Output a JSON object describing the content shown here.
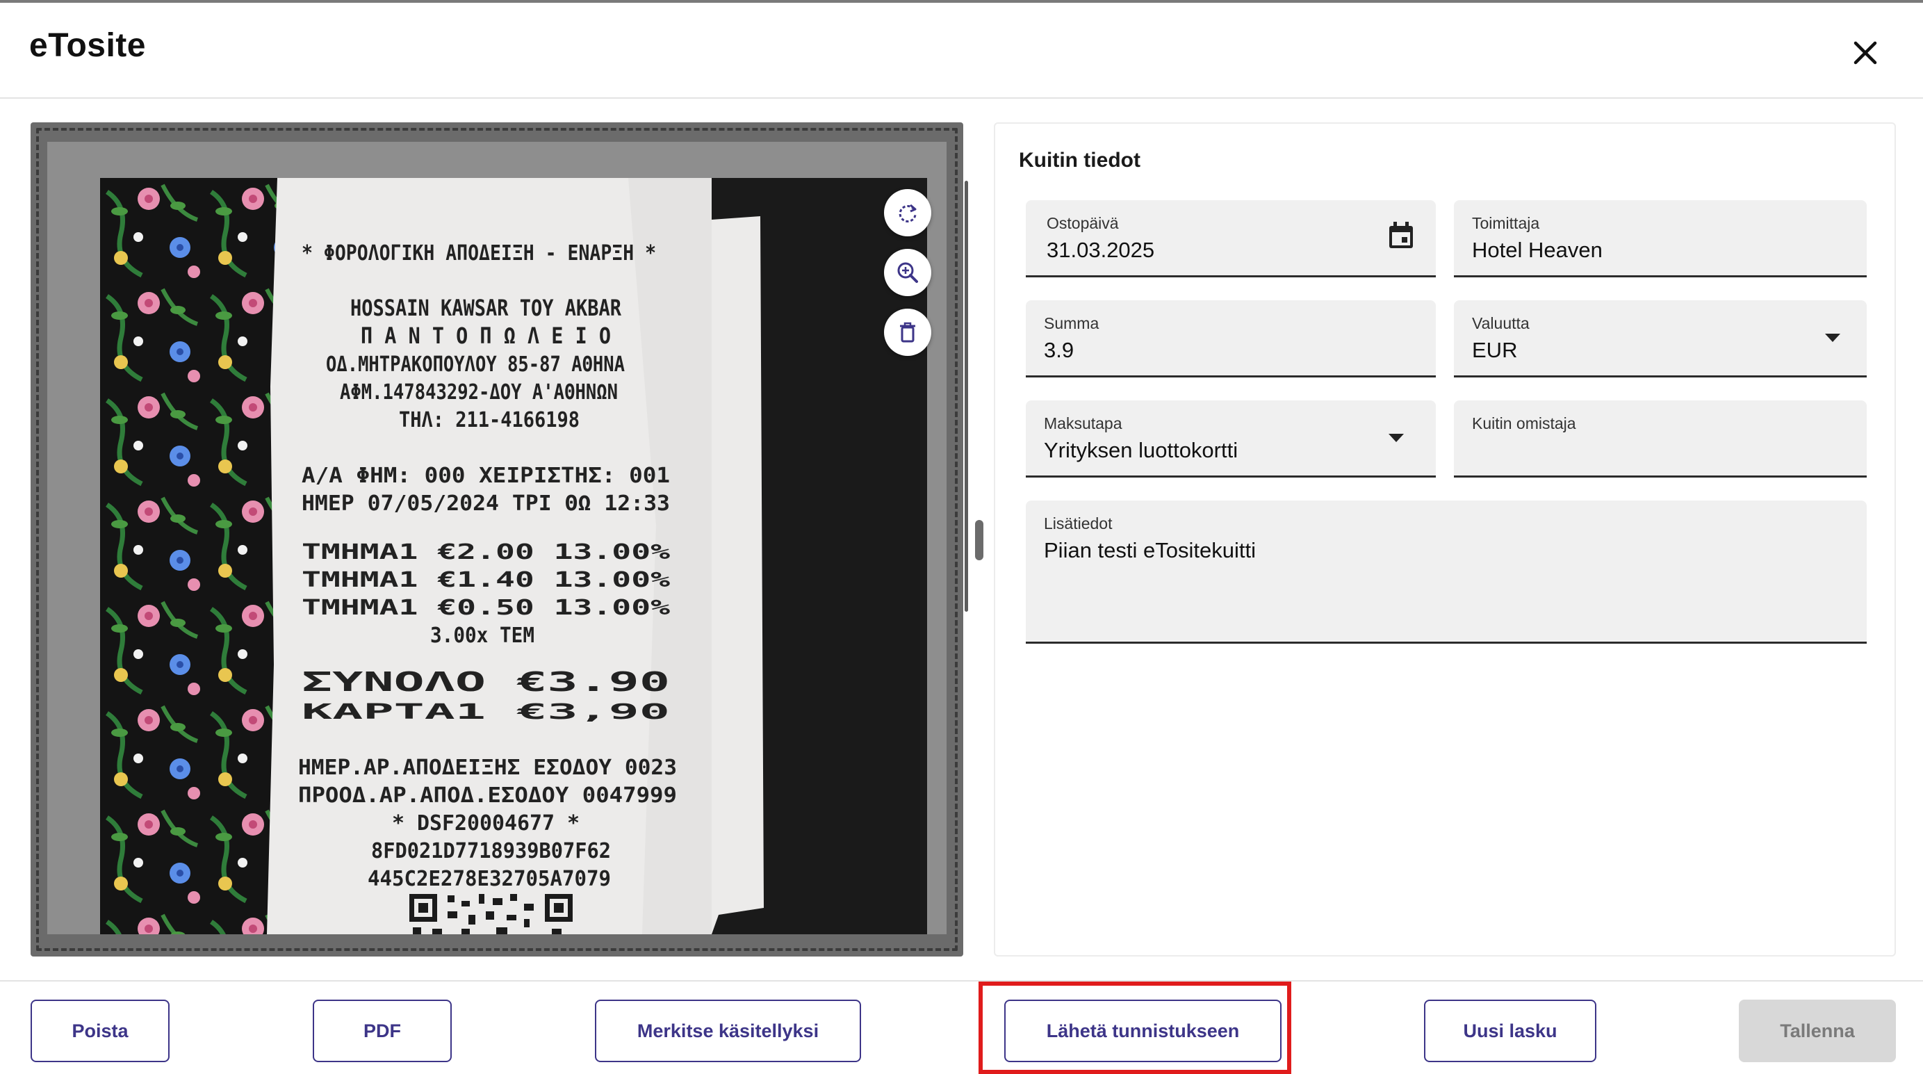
{
  "app": {
    "title": "eTosite",
    "close_icon": "close-icon"
  },
  "preview": {
    "actions": [
      {
        "name": "rotate-icon"
      },
      {
        "name": "zoom-in-icon"
      },
      {
        "name": "delete-icon"
      }
    ],
    "receipt_lines": [
      "* ΦΟΡΟΛΟΓΙΚΗ ΑΠΟΔΕΙΞΗ - ΕΝΑΡΞΗ *",
      "HOSSAIN KAWSAR TOY AKBAR",
      "Π Α Ν Τ Ο Π Ω Λ Ε Ι Ο",
      "ΟΔ.ΜΗΤΡΑΚΟΠΟΥΛΟΥ 85-87 ΑΘΗΝΑ",
      "ΑΦΜ.147843292-ΔΟΥ Α'ΑΘΗΝΩΝ",
      "ΤΗΛ: 211-4166198",
      "Α/Α ΦΗΜ: 000      ΧΕΙΡΙΣΤΗΣ: 001",
      "ΗΜΕΡ 07/05/2024 ΤΡΙ  ΘΩ    12:33",
      "ΤΜΗΜΑ1              €2.00 13.00%",
      "ΤΜΗΜΑ1              €1.40 13.00%",
      "ΤΜΗΜΑ1              €0.50 13.00%",
      "3.00x ΤΕΜ",
      "ΣΥΝΟΛΟ             €3.90",
      "ΚΑΡΤΑ1             €3,90",
      "ΗΜΕΡ.ΑΡ.ΑΠΟΔΕΙΞΗΣ ΕΣΟΔΟΥ    0023",
      "ΠΡΟΟΔ.ΑΡ.ΑΠΟΔ.ΕΣΟΔΟΥ     0047999",
      "* DSF20004677 *",
      "8FD021D7718939B07F62",
      "445C2E278E32705A7079"
    ]
  },
  "details": {
    "title": "Kuitin tiedot",
    "fields": {
      "purchase_date": {
        "label": "Ostopäivä",
        "value": "31.03.2025",
        "icon": "calendar-icon"
      },
      "supplier": {
        "label": "Toimittaja",
        "value": "Hotel Heaven"
      },
      "amount": {
        "label": "Summa",
        "value": "3.9"
      },
      "currency": {
        "label": "Valuutta",
        "value": "EUR",
        "icon": "dropdown-arrow-icon"
      },
      "payment_method": {
        "label": "Maksutapa",
        "value": "Yrityksen luottokortti",
        "icon": "dropdown-arrow-icon"
      },
      "receipt_owner": {
        "label": "Kuitin omistaja",
        "value": ""
      },
      "additional_info": {
        "label": "Lisätiedot",
        "value": "Piian testi eTositekuitti"
      }
    }
  },
  "footer": {
    "delete": "Poista",
    "pdf": "PDF",
    "mark_processed": "Merkitse käsitellyksi",
    "send_recognition": "Lähetä tunnistukseen",
    "new_invoice": "Uusi lasku",
    "save": "Tallenna"
  },
  "colors": {
    "accent": "#3d3588",
    "highlight": "#e01c1c",
    "field_bg": "#f0f0f0",
    "preview_bg": "#6b6b6b"
  }
}
